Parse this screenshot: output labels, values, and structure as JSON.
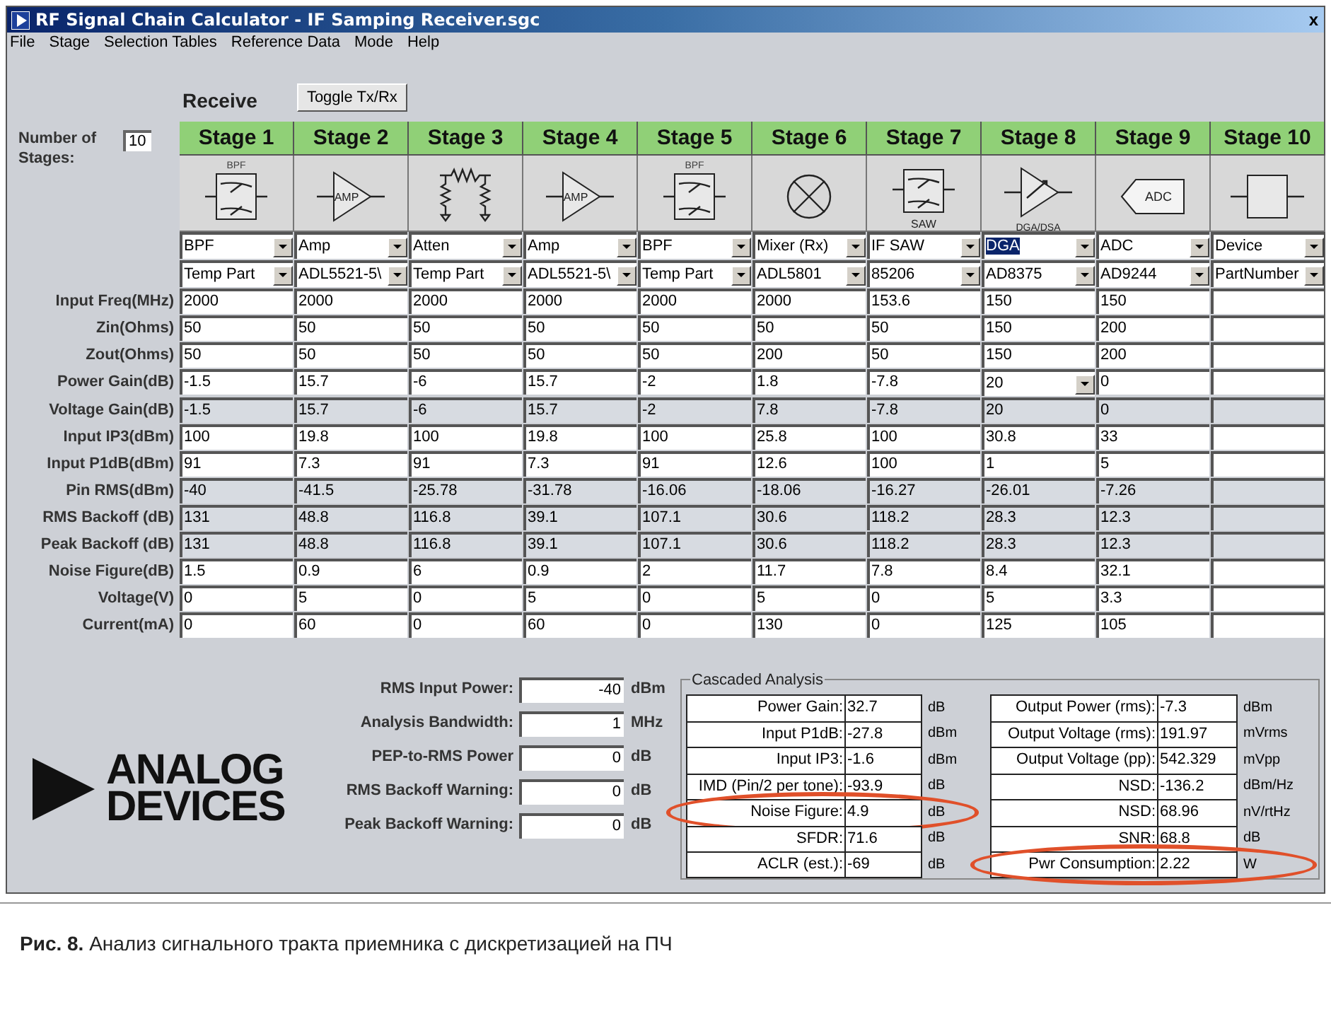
{
  "window": {
    "title": "RF Signal Chain Calculator - IF Samping Receiver.sgc",
    "close": "x"
  },
  "menu": [
    "File",
    "Stage",
    "Selection Tables",
    "Reference Data",
    "Mode",
    "Help"
  ],
  "mode_label": "Receive",
  "toggle_button": "Toggle Tx/Rx",
  "number_of_stages": {
    "label": "Number of Stages:",
    "value": "10"
  },
  "stages": [
    {
      "title": "Stage 1",
      "kind": "bpf",
      "icon_text": "BPF",
      "type": "BPF",
      "type_highlighted": false,
      "part": "Temp Part"
    },
    {
      "title": "Stage 2",
      "kind": "amp",
      "icon_text": "AMP",
      "type": "Amp",
      "type_highlighted": false,
      "part": "ADL5521-5\\"
    },
    {
      "title": "Stage 3",
      "kind": "atten",
      "type": "Atten",
      "type_highlighted": false,
      "part": "Temp Part"
    },
    {
      "title": "Stage 4",
      "kind": "amp",
      "icon_text": "AMP",
      "type": "Amp",
      "type_highlighted": false,
      "part": "ADL5521-5\\"
    },
    {
      "title": "Stage 5",
      "kind": "bpf",
      "icon_text": "BPF",
      "type": "BPF",
      "type_highlighted": false,
      "part": "Temp Part"
    },
    {
      "title": "Stage 6",
      "kind": "mixer",
      "type": "Mixer (Rx)",
      "type_highlighted": false,
      "part": "ADL5801"
    },
    {
      "title": "Stage 7",
      "kind": "saw",
      "icon_text": "SAW",
      "type": "IF SAW",
      "type_highlighted": false,
      "part": "85206"
    },
    {
      "title": "Stage 8",
      "kind": "dga",
      "icon_text": "DGA/DSA",
      "type": "DGA",
      "type_highlighted": true,
      "part": "AD8375"
    },
    {
      "title": "Stage 9",
      "kind": "adc",
      "icon_text": "ADC",
      "type": "ADC",
      "type_highlighted": false,
      "part": "AD9244"
    },
    {
      "title": "Stage 10",
      "kind": "device",
      "type": "Device",
      "type_highlighted": false,
      "part": "PartNumber"
    }
  ],
  "rows": [
    {
      "label": "Input Freq(MHz)",
      "computed": false,
      "values": [
        "2000",
        "2000",
        "2000",
        "2000",
        "2000",
        "2000",
        "153.6",
        "150",
        "150"
      ]
    },
    {
      "label": "Zin(Ohms)",
      "computed": false,
      "values": [
        "50",
        "50",
        "50",
        "50",
        "50",
        "50",
        "50",
        "150",
        "200"
      ]
    },
    {
      "label": "Zout(Ohms)",
      "computed": false,
      "values": [
        "50",
        "50",
        "50",
        "50",
        "50",
        "200",
        "50",
        "150",
        "200"
      ]
    },
    {
      "label": "Power Gain(dB)",
      "computed": false,
      "values": [
        "-1.5",
        "15.7",
        "-6",
        "15.7",
        "-2",
        "1.8",
        "-7.8",
        {
          "value": "20",
          "kind": "dropdown"
        },
        "0"
      ]
    },
    {
      "label": "Voltage Gain(dB)",
      "computed": true,
      "values": [
        "-1.5",
        "15.7",
        "-6",
        "15.7",
        "-2",
        "7.8",
        "-7.8",
        "20",
        "0"
      ]
    },
    {
      "label": "Input IP3(dBm)",
      "computed": false,
      "values": [
        "100",
        "19.8",
        "100",
        "19.8",
        "100",
        "25.8",
        "100",
        "30.8",
        "33"
      ]
    },
    {
      "label": "Input P1dB(dBm)",
      "computed": false,
      "values": [
        "91",
        "7.3",
        "91",
        "7.3",
        "91",
        "12.6",
        "100",
        "1",
        "5"
      ]
    },
    {
      "label": "Pin RMS(dBm)",
      "computed": true,
      "values": [
        "-40",
        "-41.5",
        "-25.78",
        "-31.78",
        "-16.06",
        "-18.06",
        "-16.27",
        "-26.01",
        "-7.26"
      ]
    },
    {
      "label": "RMS Backoff (dB)",
      "computed": true,
      "values": [
        "131",
        "48.8",
        "116.8",
        "39.1",
        "107.1",
        "30.6",
        "118.2",
        "28.3",
        "12.3"
      ]
    },
    {
      "label": "Peak Backoff (dB)",
      "computed": true,
      "values": [
        "131",
        "48.8",
        "116.8",
        "39.1",
        "107.1",
        "30.6",
        "118.2",
        "28.3",
        "12.3"
      ]
    },
    {
      "label": "Noise Figure(dB)",
      "computed": false,
      "values": [
        "1.5",
        "0.9",
        "6",
        "0.9",
        "2",
        "11.7",
        "7.8",
        "8.4",
        "32.1"
      ]
    },
    {
      "label": "Voltage(V)",
      "computed": false,
      "values": [
        "0",
        "5",
        "0",
        "5",
        "0",
        "5",
        "0",
        "5",
        "3.3"
      ]
    },
    {
      "label": "Current(mA)",
      "computed": false,
      "values": [
        "0",
        "60",
        "0",
        "60",
        "0",
        "130",
        "0",
        "125",
        "105"
      ]
    }
  ],
  "logo": {
    "line_1": "ANALOG",
    "line_2": "DEVICES"
  },
  "inputs": [
    {
      "label": "RMS Input Power:",
      "value": "-40",
      "unit": "dBm"
    },
    {
      "label": "Analysis Bandwidth:",
      "value": "1",
      "unit": "MHz"
    },
    {
      "label": "PEP-to-RMS Power",
      "value": "0",
      "unit": "dB"
    },
    {
      "label": "RMS Backoff Warning:",
      "value": "0",
      "unit": "dB"
    },
    {
      "label": "Peak Backoff Warning:",
      "value": "0",
      "unit": "dB"
    }
  ],
  "cascaded_analysis": {
    "title": "Cascaded Analysis",
    "left": [
      {
        "label": "Power Gain:",
        "value": "32.7",
        "unit": "dB",
        "circled": false
      },
      {
        "label": "Input P1dB:",
        "value": "-27.8",
        "unit": "dBm",
        "circled": false
      },
      {
        "label": "Input IP3:",
        "value": "-1.6",
        "unit": "dBm",
        "circled": false
      },
      {
        "label": "IMD (Pin/2 per tone):",
        "value": "-93.9",
        "unit": "dB",
        "circled": false
      },
      {
        "label": "Noise Figure:",
        "value": "4.9",
        "unit": "dB",
        "circled": true
      },
      {
        "label": "SFDR:",
        "value": "71.6",
        "unit": "dB",
        "circled": false
      },
      {
        "label": "ACLR (est.):",
        "value": "-69",
        "unit": "dB",
        "circled": false
      }
    ],
    "right": [
      {
        "label": "Output Power (rms):",
        "value": "-7.3",
        "unit": "dBm",
        "circled": false
      },
      {
        "label": "Output Voltage (rms):",
        "value": "191.97",
        "unit": "mVrms",
        "circled": false
      },
      {
        "label": "Output Voltage (pp):",
        "value": "542.329",
        "unit": "mVpp",
        "circled": false
      },
      {
        "label": "NSD:",
        "value": "-136.2",
        "unit": "dBm/Hz",
        "circled": false
      },
      {
        "label": "NSD:",
        "value": "68.96",
        "unit": "nV/rtHz",
        "circled": false
      },
      {
        "label": "SNR:",
        "value": "68.8",
        "unit": "dB",
        "circled": false
      },
      {
        "label": "Pwr Consumption:",
        "value": "2.22",
        "unit": "W",
        "circled": true
      }
    ]
  },
  "caption": "**Рис. 8.** Анализ сигнального тракта приемника с дискретизацией на ПЧ"
}
